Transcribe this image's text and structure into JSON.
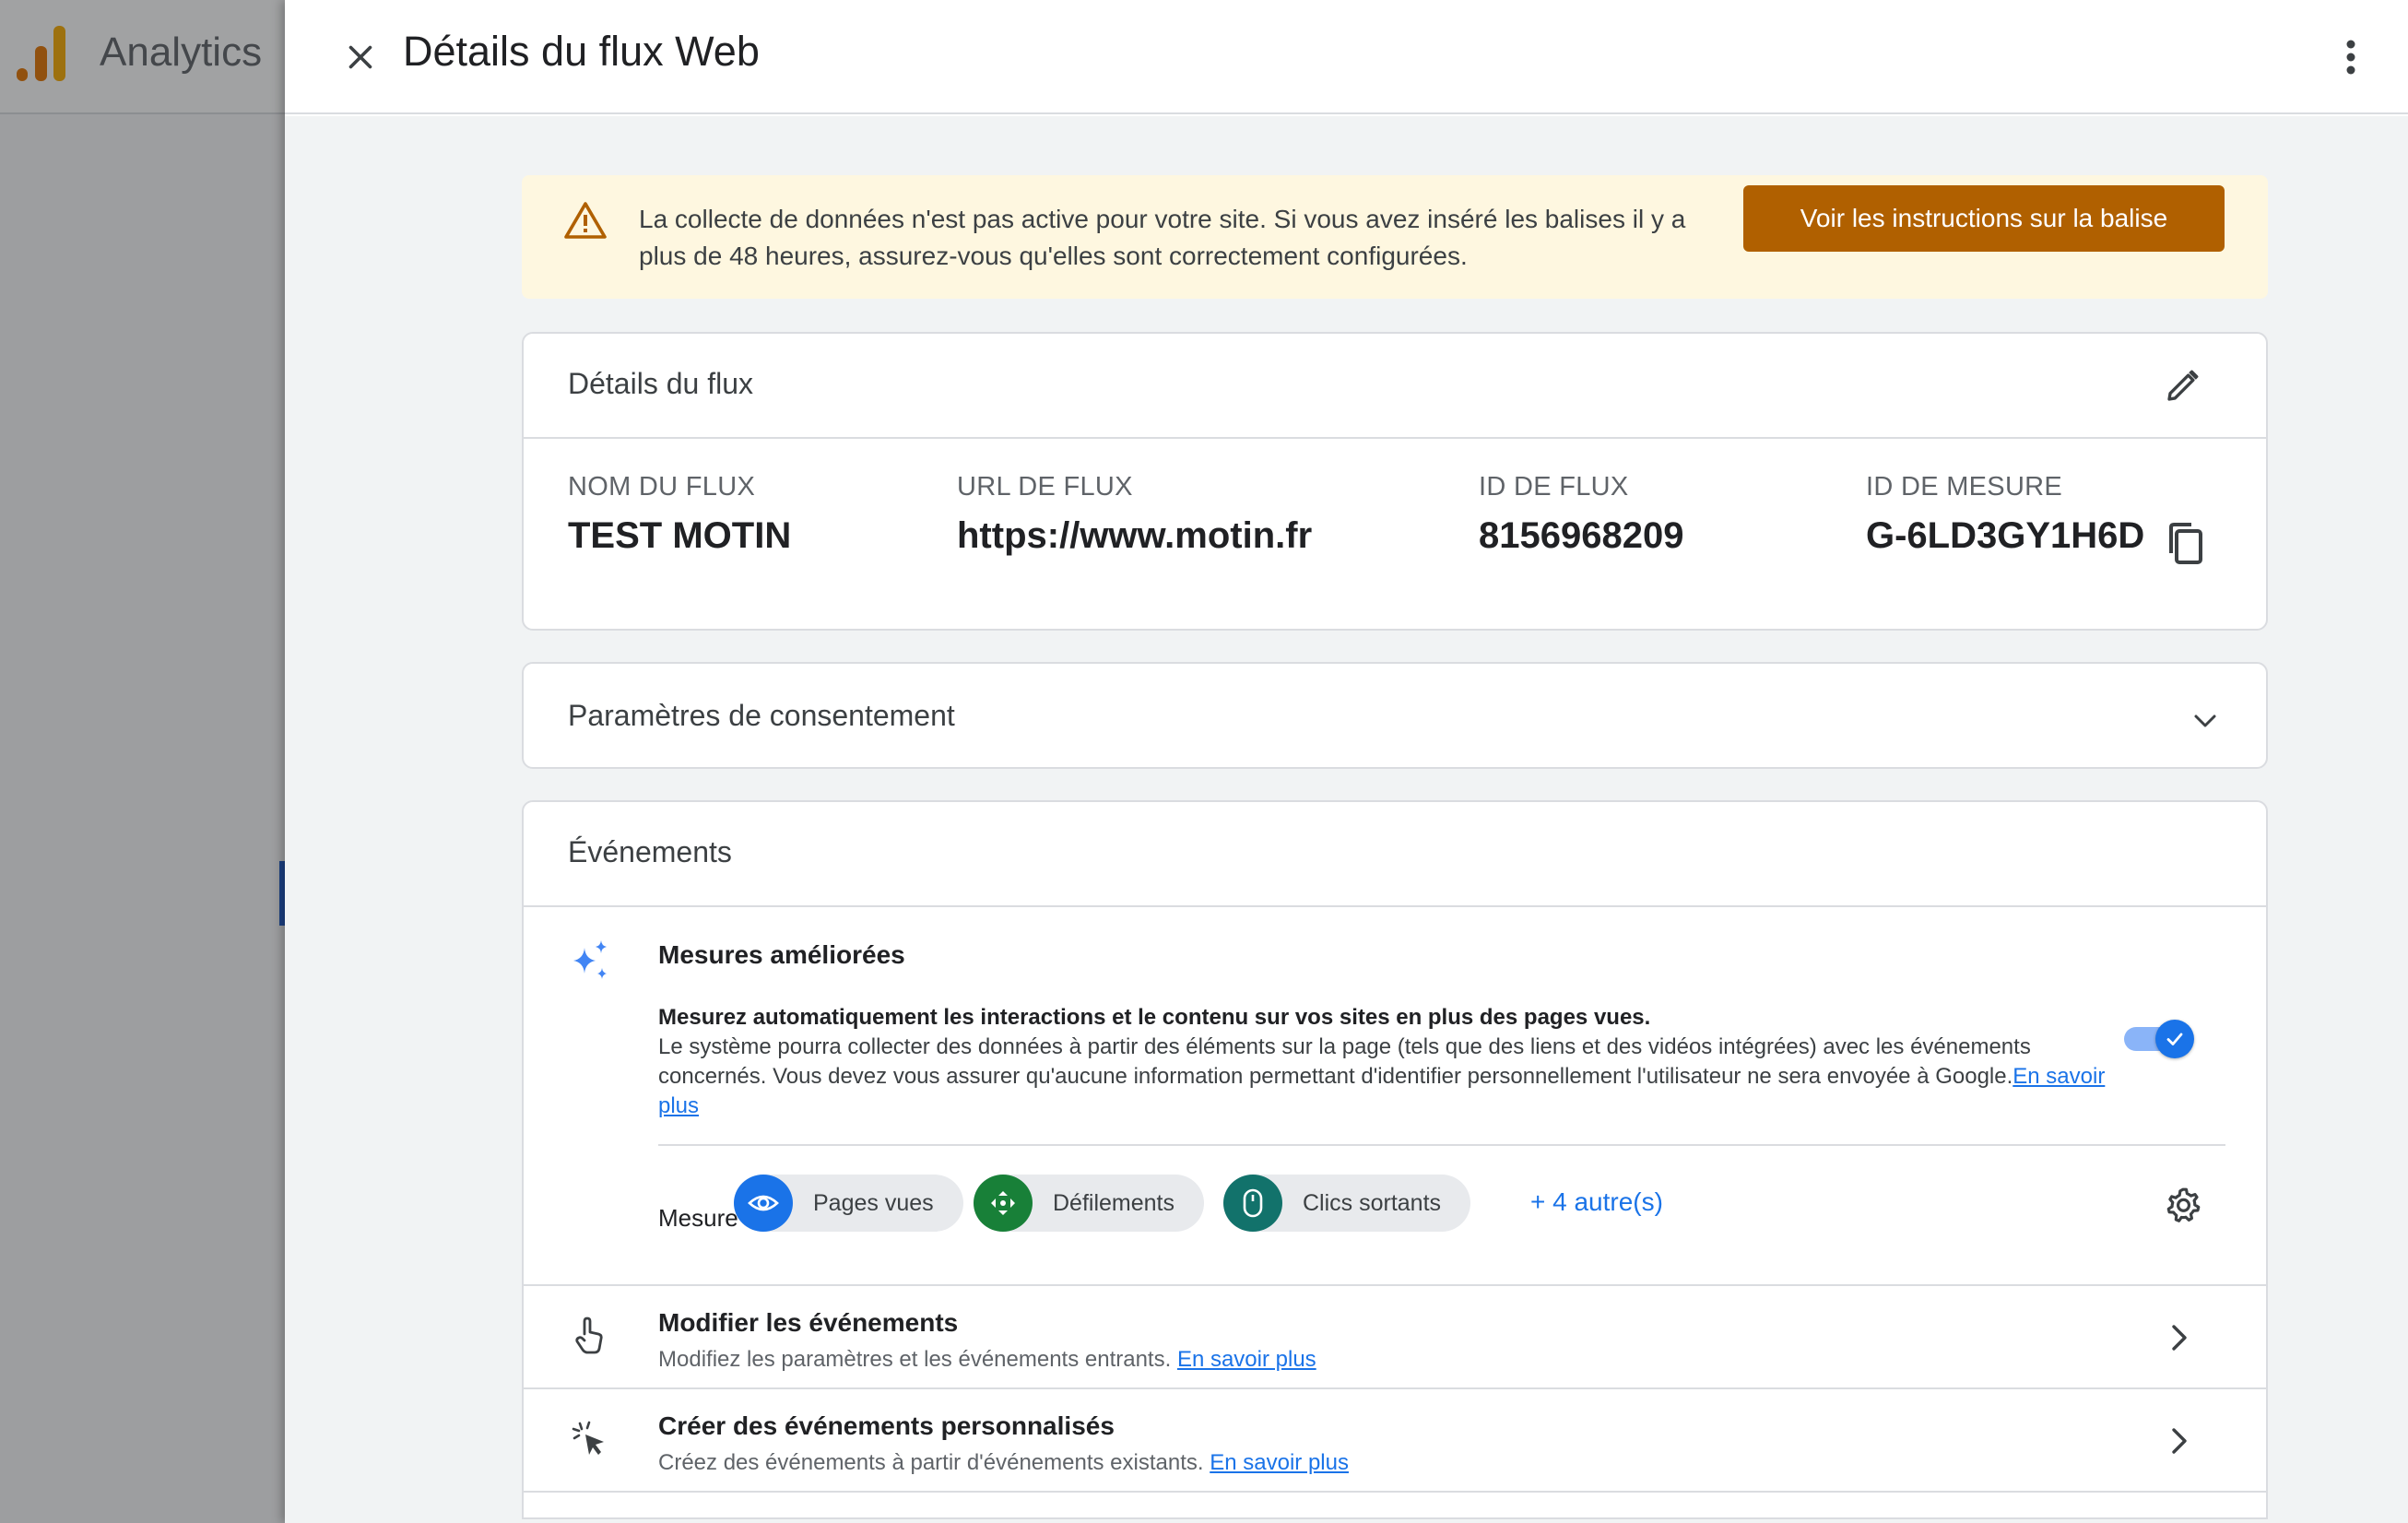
{
  "app": {
    "name": "Analytics",
    "logo_icon": "analytics-logo-icon",
    "brand_colors": [
      "#e37400",
      "#f9ab00"
    ]
  },
  "drawer": {
    "title": "Détails du flux Web",
    "close_icon": "close-icon",
    "more_icon": "more-vert-icon"
  },
  "banner": {
    "icon": "warning-icon",
    "text": "La collecte de données n'est pas active pour votre site. Si vous avez inséré les balises il y a plus de 48 heures, assurez-vous qu'elles sont correctement configurées.",
    "button_label": "Voir les instructions sur la balise",
    "button_color": "#b06000",
    "background": "#fef7e0"
  },
  "stream_details": {
    "title": "Détails du flux",
    "edit_icon": "edit-pencil-icon",
    "fields": [
      {
        "label": "NOM DU FLUX",
        "value": "TEST MOTIN"
      },
      {
        "label": "URL DE FLUX",
        "value": "https://www.motin.fr"
      },
      {
        "label": "ID DE FLUX",
        "value": "8156968209"
      },
      {
        "label": "ID DE MESURE",
        "value": "G-6LD3GY1H6D"
      }
    ],
    "copy_icon": "copy-icon"
  },
  "consent": {
    "title": "Paramètres de consentement",
    "icon": "chevron-down-icon"
  },
  "events": {
    "title": "Événements",
    "enhanced": {
      "icon": "sparkle-icon",
      "title": "Mesures améliorées",
      "desc_bold": "Mesurez automatiquement les interactions et le contenu sur vos sites en plus des pages vues.",
      "desc": "Le système pourra collecter des données à partir des éléments sur la page (tels que des liens et des vidéos intégrées) avec les événements concernés. Vous devez vous assurer qu'aucune information permettant d'identifier personnellement l'utilisateur ne sera envoyée à Google.",
      "link": "En savoir plus",
      "toggle_on": true,
      "measure_label": "Mesure :",
      "chips": [
        {
          "label": "Pages vues",
          "icon": "eye-icon",
          "color": "#1a73e8"
        },
        {
          "label": "Défilements",
          "icon": "scroll-arrows-icon",
          "color": "#188038"
        },
        {
          "label": "Clics sortants",
          "icon": "mouse-icon",
          "color": "#12726b"
        }
      ],
      "more_label": "+ 4 autre(s)",
      "settings_icon": "gear-icon"
    },
    "rows": [
      {
        "icon": "touch-hand-icon",
        "title": "Modifier les événements",
        "sub": "Modifiez les paramètres et les événements entrants.",
        "link": "En savoir plus"
      },
      {
        "icon": "cursor-click-icon",
        "title": "Créer des événements personnalisés",
        "sub": "Créez des événements à partir d'événements existants.",
        "link": "En savoir plus"
      }
    ]
  }
}
